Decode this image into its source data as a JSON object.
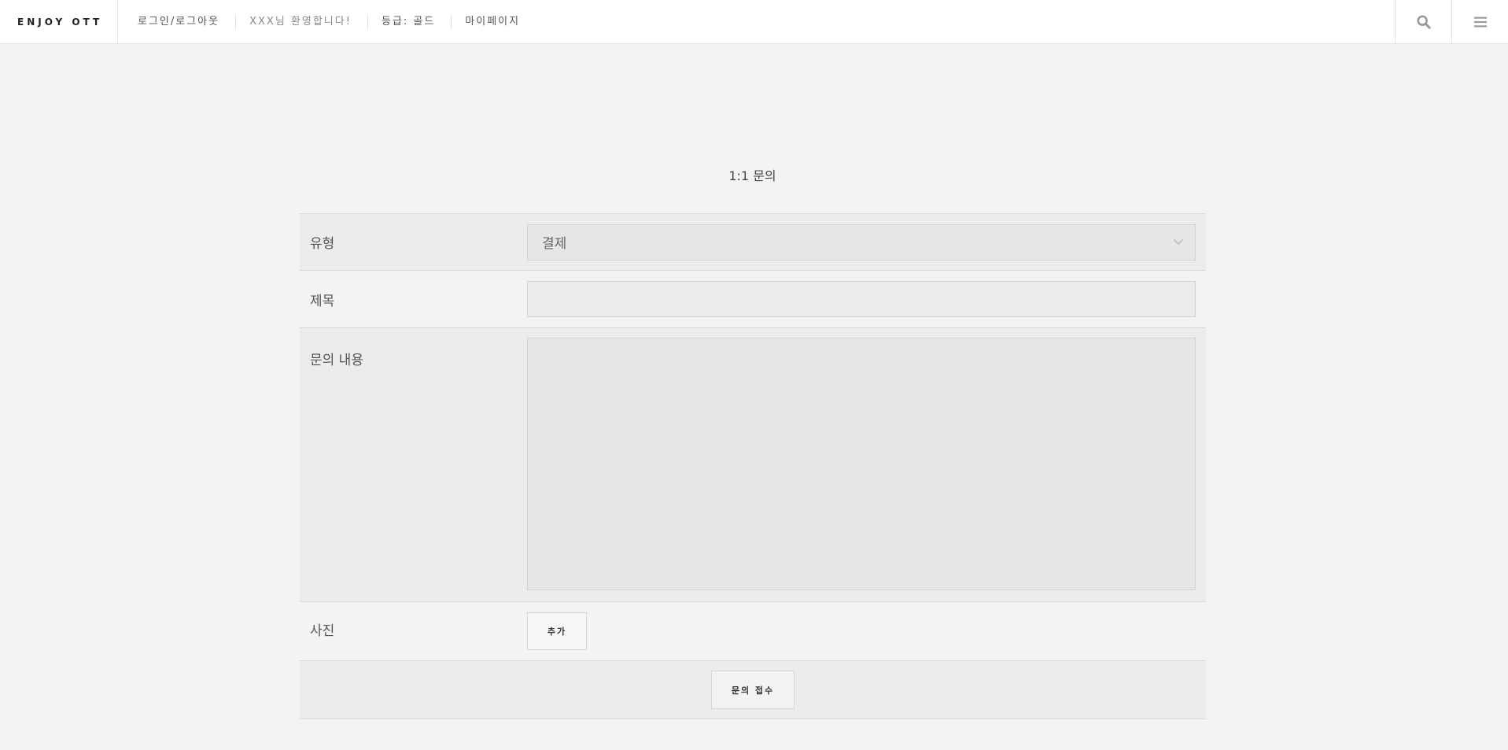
{
  "header": {
    "brand": "ENJOY OTT",
    "nav": [
      {
        "label": "로그인/로그아웃"
      },
      {
        "label": "XXX님 환영합니다!"
      },
      {
        "label": "등급: 골드"
      },
      {
        "label": "마이페이지"
      }
    ],
    "icons": {
      "search": "search-icon",
      "menu": "hamburger-menu-icon"
    }
  },
  "page": {
    "title": "1:1 문의"
  },
  "form": {
    "type": {
      "label": "유형",
      "selected": "결제"
    },
    "subject": {
      "label": "제목",
      "value": ""
    },
    "content": {
      "label": "문의 내용",
      "value": ""
    },
    "photo": {
      "label": "사진",
      "add_button": "추가"
    },
    "submit_button": "문의 접수"
  }
}
